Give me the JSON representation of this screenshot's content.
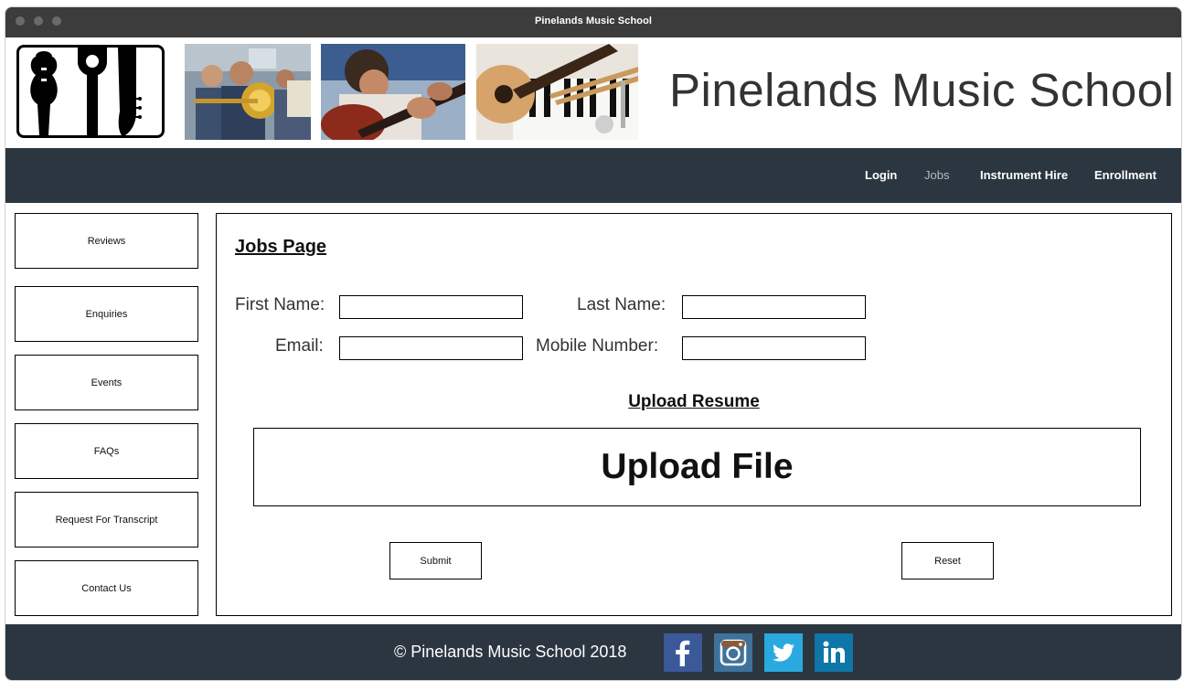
{
  "window": {
    "title": "Pinelands Music School"
  },
  "header": {
    "site_title": "Pinelands Music School",
    "logo_icon": "music-school-logo-icon",
    "photos": [
      "brass-band-photo",
      "guitar-lesson-photo",
      "instruments-photo"
    ]
  },
  "nav": {
    "items": [
      {
        "label": "Login",
        "active": false
      },
      {
        "label": "Jobs",
        "active": true
      },
      {
        "label": "Instrument Hire",
        "active": false
      },
      {
        "label": "Enrollment",
        "active": false
      }
    ]
  },
  "sidebar": {
    "items": [
      {
        "label": "Reviews"
      },
      {
        "label": "Enquiries"
      },
      {
        "label": "Events"
      },
      {
        "label": "FAQs"
      },
      {
        "label": "Request For Transcript"
      },
      {
        "label": "Contact Us"
      }
    ]
  },
  "main": {
    "heading": "Jobs Page",
    "form": {
      "first_name_label": "First Name:",
      "first_name_value": "",
      "last_name_label": "Last Name:",
      "last_name_value": "",
      "email_label": "Email:",
      "email_value": "",
      "mobile_label": "Mobile Number:",
      "mobile_value": ""
    },
    "upload_heading": "Upload Resume",
    "upload_button": "Upload File",
    "submit_label": "Submit",
    "reset_label": "Reset"
  },
  "footer": {
    "copyright": "© Pinelands Music School   2018",
    "social": [
      {
        "icon": "facebook-icon",
        "color": "#3b5998"
      },
      {
        "icon": "instagram-icon",
        "color": "#3f729b"
      },
      {
        "icon": "twitter-icon",
        "color": "#2aa9e0"
      },
      {
        "icon": "linkedin-icon",
        "color": "#0e76a8"
      }
    ]
  },
  "colors": {
    "navbar": "#2b3640",
    "titlebar": "#3c3c3c",
    "nav_muted": "#b7bcc1"
  }
}
